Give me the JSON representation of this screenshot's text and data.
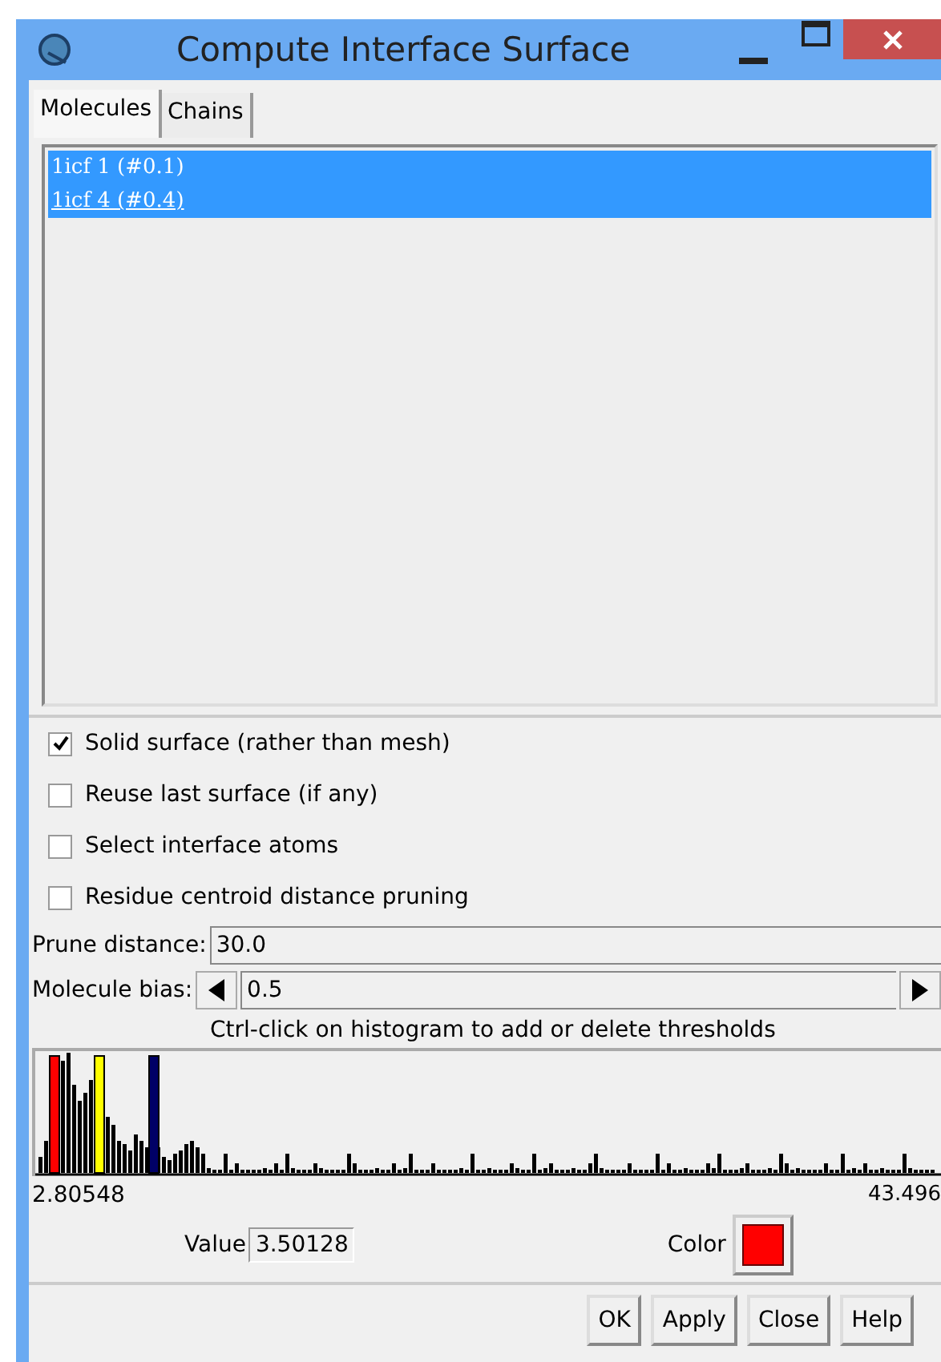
{
  "window": {
    "title": "Compute Interface Surface"
  },
  "tabs": [
    {
      "label": "Molecules",
      "selected": true
    },
    {
      "label": "Chains",
      "selected": false
    }
  ],
  "molecules": [
    {
      "label": "1icf 1 (#0.1)",
      "selected": true,
      "focused": false
    },
    {
      "label": "1icf 4 (#0.4)",
      "selected": true,
      "focused": true
    }
  ],
  "options": [
    {
      "label": "Solid surface (rather than mesh)",
      "checked": true
    },
    {
      "label": "Reuse last surface (if any)",
      "checked": false
    },
    {
      "label": "Select interface atoms",
      "checked": false
    },
    {
      "label": "Residue centroid distance pruning",
      "checked": false
    }
  ],
  "prune_distance": {
    "label": "Prune distance:",
    "value": "30.0"
  },
  "molecule_bias": {
    "label": "Molecule bias:",
    "value": "0.5"
  },
  "histogram": {
    "hint": "Ctrl-click on histogram to add or delete thresholds",
    "min": "2.80548",
    "max": "43.496"
  },
  "threshold": {
    "value_label": "Value",
    "value": "3.50128",
    "color_label": "Color",
    "color": "#ff0000"
  },
  "buttons": [
    "OK",
    "Apply",
    "Close",
    "Help"
  ]
}
